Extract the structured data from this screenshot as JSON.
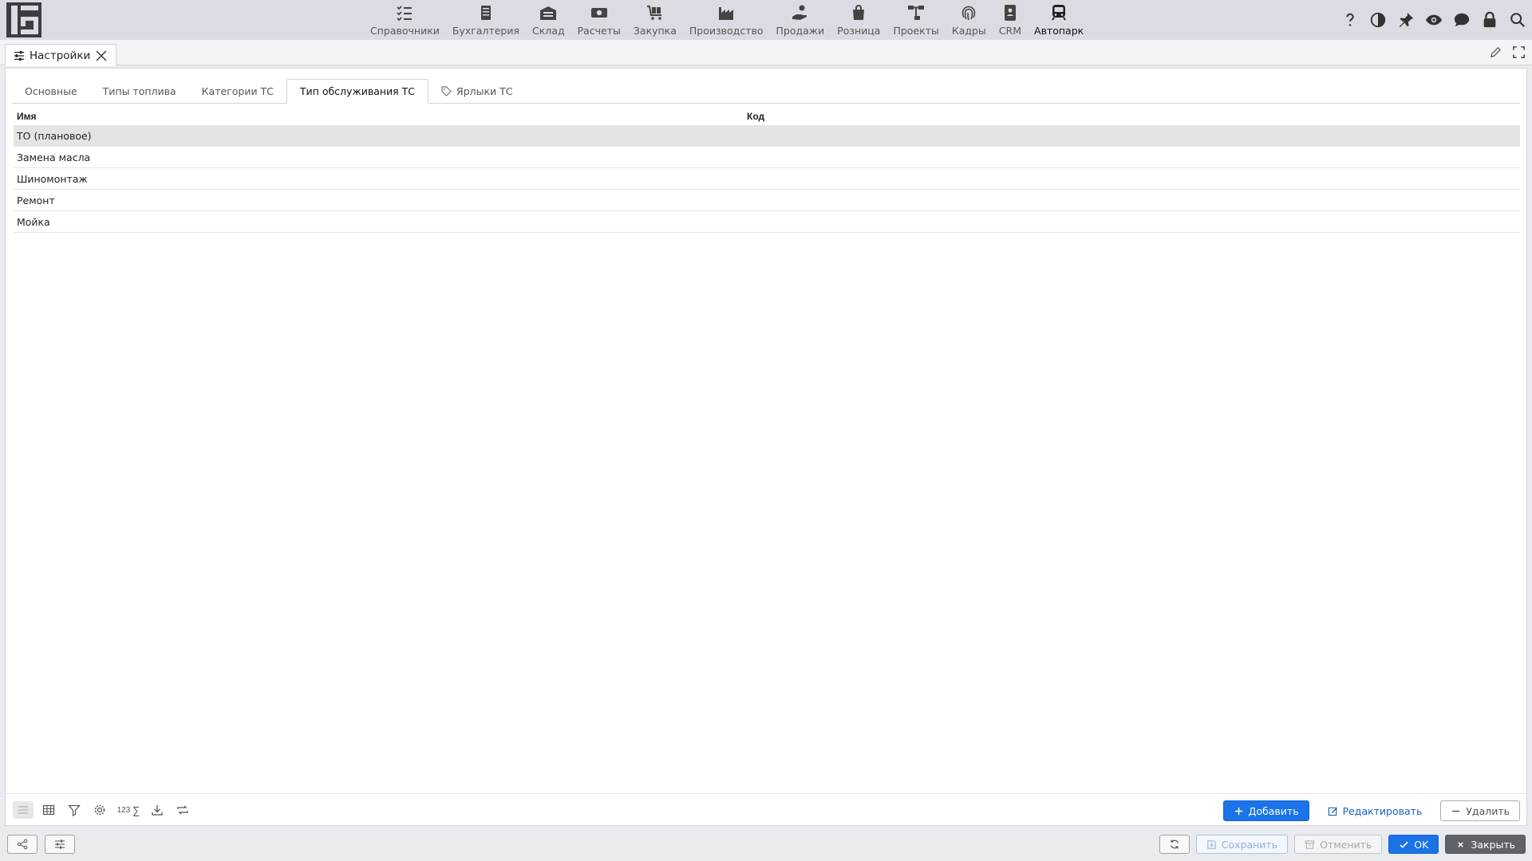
{
  "nav": {
    "items": [
      {
        "label": "Справочники",
        "icon": "checklist-icon"
      },
      {
        "label": "Бухгалтерия",
        "icon": "ledger-icon"
      },
      {
        "label": "Склад",
        "icon": "warehouse-icon"
      },
      {
        "label": "Расчеты",
        "icon": "money-icon"
      },
      {
        "label": "Закупка",
        "icon": "cart-icon"
      },
      {
        "label": "Производство",
        "icon": "factory-icon"
      },
      {
        "label": "Продажи",
        "icon": "hand-coin-icon"
      },
      {
        "label": "Розница",
        "icon": "shopping-bag-icon"
      },
      {
        "label": "Проекты",
        "icon": "project-tree-icon"
      },
      {
        "label": "Кадры",
        "icon": "fingerprint-icon"
      },
      {
        "label": "CRM",
        "icon": "contact-card-icon"
      },
      {
        "label": "Автопарк",
        "icon": "bus-icon"
      }
    ],
    "active": "Автопарк"
  },
  "doc_tab": {
    "label": "Настройки"
  },
  "tabs": [
    {
      "label": "Основные"
    },
    {
      "label": "Типы топлива"
    },
    {
      "label": "Категории ТС"
    },
    {
      "label": "Тип обслуживания ТС"
    },
    {
      "label": "Ярлыки ТС"
    }
  ],
  "active_tab": "Тип обслуживания ТС",
  "table": {
    "columns": [
      "Имя",
      "Код"
    ],
    "rows": [
      {
        "name": "ТО (плановое)",
        "code": ""
      },
      {
        "name": "Замена масла",
        "code": ""
      },
      {
        "name": "Шиномонтаж",
        "code": ""
      },
      {
        "name": "Ремонт",
        "code": ""
      },
      {
        "name": "Мойка",
        "code": ""
      }
    ],
    "selected_row": 0
  },
  "footer_tools": {
    "numbers_label": "123",
    "sum_label": "∑"
  },
  "actions": {
    "add": "Добавить",
    "edit": "Редактировать",
    "delete": "Удалить"
  },
  "window_buttons": {
    "save": "Сохранить",
    "cancel": "Отменить",
    "ok": "OK",
    "close": "Закрыть"
  },
  "colors": {
    "primary": "#1a73e8",
    "close_button": "#5f6368",
    "selected_row": "#e4e4e4",
    "topbar": "#d9dde3"
  }
}
